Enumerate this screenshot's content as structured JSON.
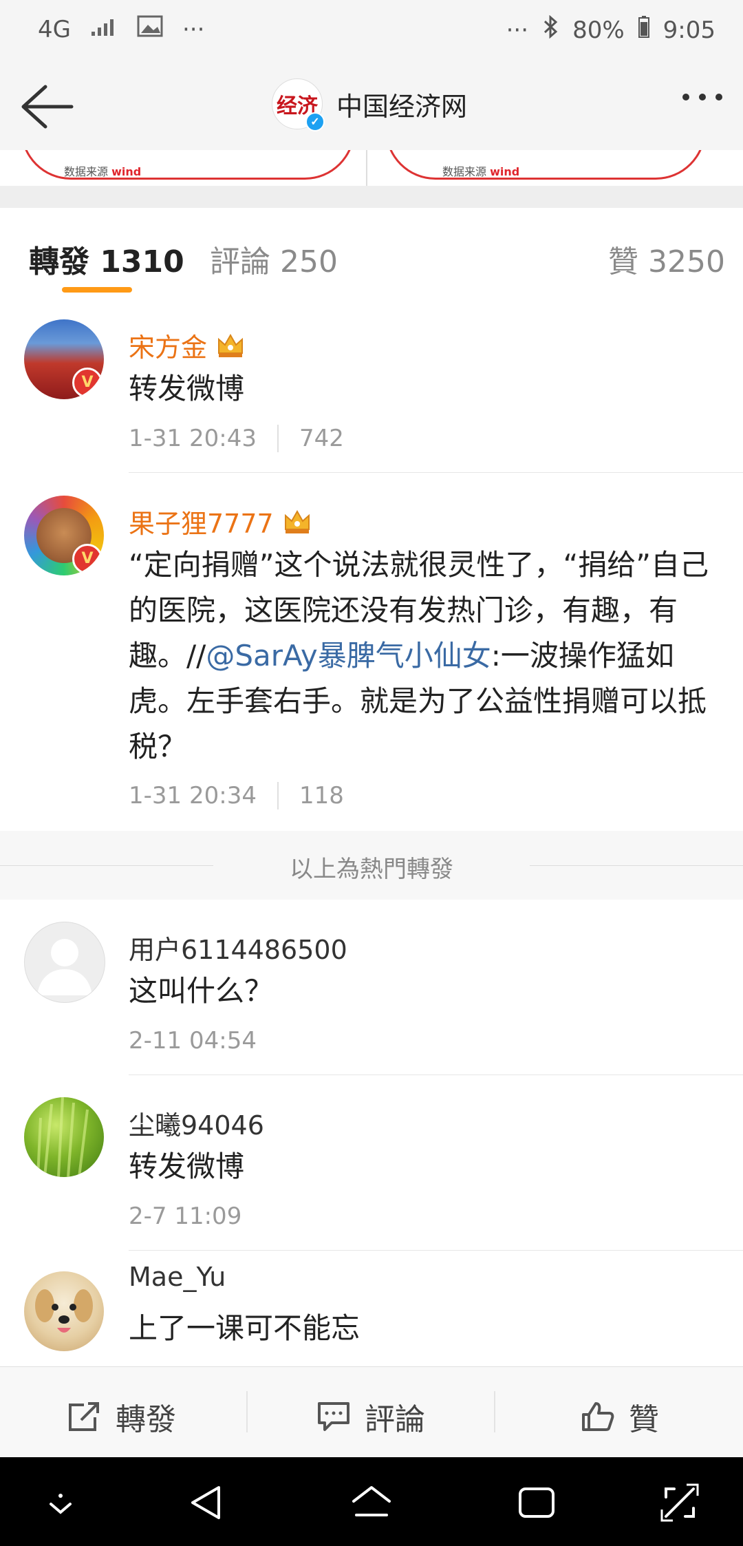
{
  "status_bar": {
    "network": "4G",
    "more_left": "···",
    "more_right": "···",
    "battery": "80%",
    "time": "9:05"
  },
  "header": {
    "logo_text": "经济",
    "title": "中国经济网"
  },
  "image_strip": {
    "caption_prefix": "数据来源",
    "caption_brand": "wind"
  },
  "tabs": [
    {
      "label": "轉發 1310"
    },
    {
      "label": "評論 250"
    },
    {
      "label": "贊 3250"
    }
  ],
  "items": [
    {
      "username": "宋方金",
      "content": "转发微博",
      "time": "1-31 20:43",
      "likes": "742"
    },
    {
      "username": "果子狸7777",
      "content_before": "“定向捐赠”这个说法就很灵性了，“捐给”自己的医院，这医院还没有发热门诊，有趣，有趣。//",
      "mention": "@SarAy暴脾气小仙女",
      "content_after": ":一波操作猛如虎。左手套右手。就是为了公益性捐赠可以抵税？",
      "time": "1-31 20:34",
      "likes": "118"
    },
    {
      "username": "用户6114486500",
      "content": "这叫什么？",
      "time": "2-11 04:54"
    },
    {
      "username": "尘曦94046",
      "content": "转发微博",
      "time": "2-7 11:09"
    },
    {
      "username": "Mae_Yu",
      "content": "上了一课可不能忘"
    }
  ],
  "hot_separator": "以上為熱門轉發",
  "bottom_actions": {
    "repost": "轉發",
    "comment": "評論",
    "like": "贊"
  },
  "colors": {
    "accent": "#ff9a16",
    "vip_name": "#eb7315",
    "mention": "#3a6aa4"
  }
}
